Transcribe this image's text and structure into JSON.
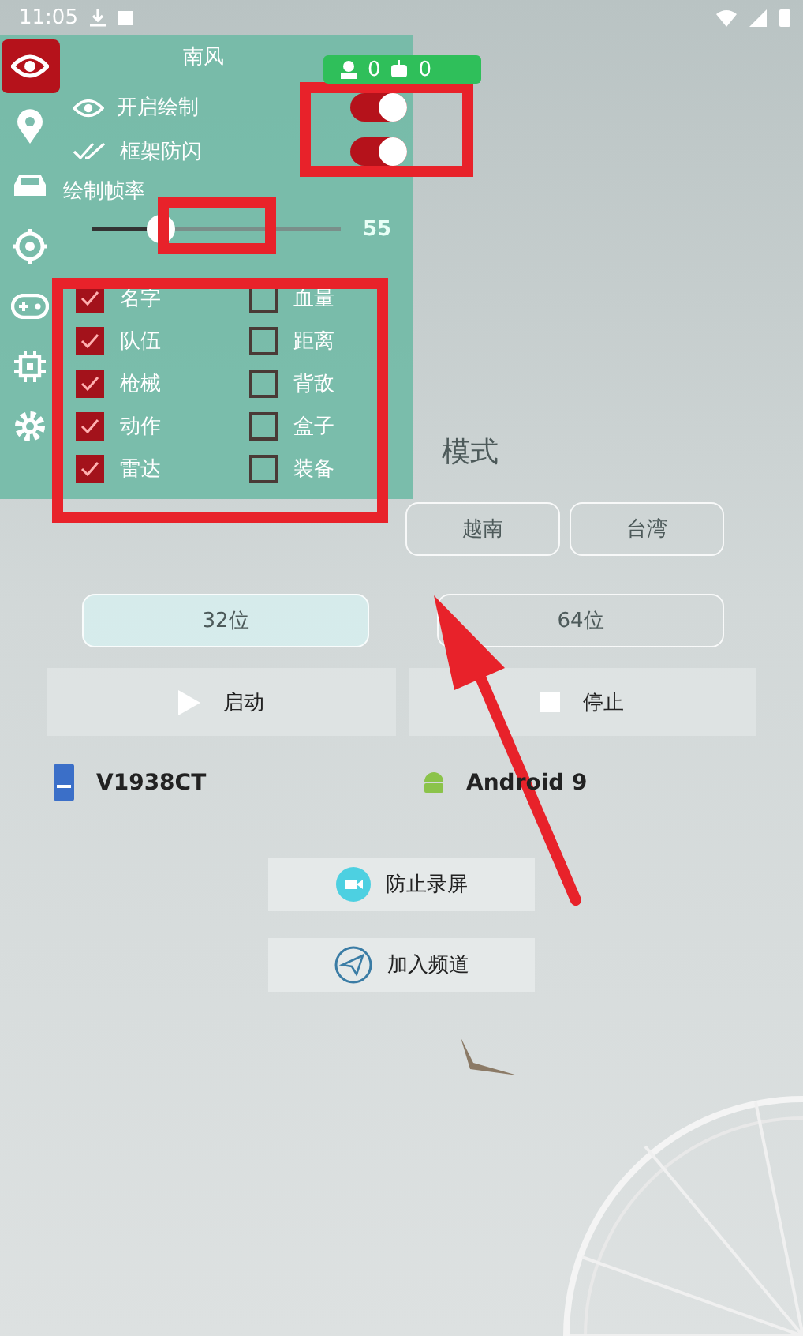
{
  "status_bar": {
    "time": "11:05"
  },
  "menu": {
    "title": "南风",
    "tabs": [
      {
        "selected": true
      },
      {
        "selected": false
      },
      {
        "selected": false
      },
      {
        "selected": false
      },
      {
        "selected": false
      },
      {
        "selected": false
      },
      {
        "selected": false
      }
    ],
    "switches": [
      {
        "label": "开启绘制",
        "on": true
      },
      {
        "label": "框架防闪",
        "on": true
      }
    ],
    "slider": {
      "label": "绘制帧率",
      "level": 0.28,
      "reading": "55"
    },
    "features": [
      {
        "label": "名字",
        "checked": true
      },
      {
        "label": "血量",
        "checked": false
      },
      {
        "label": "队伍",
        "checked": true
      },
      {
        "label": "距离",
        "checked": false
      },
      {
        "label": "枪械",
        "checked": true
      },
      {
        "label": "背敌",
        "checked": false
      },
      {
        "label": "动作",
        "checked": true
      },
      {
        "label": "盒子",
        "checked": false
      },
      {
        "label": "雷达",
        "checked": true
      },
      {
        "label": "装备",
        "checked": false
      }
    ]
  },
  "counter_badge": {
    "values": [
      "0",
      "0"
    ]
  },
  "mode_title": "模式",
  "regions": [
    {
      "label": "越南",
      "selected": false
    },
    {
      "label": "台湾",
      "selected": false
    }
  ],
  "arch": [
    {
      "label": "32位",
      "selected": true
    },
    {
      "label": "64位",
      "selected": false
    }
  ],
  "actions": [
    {
      "label": "启动",
      "kind": "play"
    },
    {
      "label": "停止",
      "kind": "stop"
    }
  ],
  "device": {
    "model": "V1938CT",
    "os": "Android 9"
  },
  "extra_buttons": [
    {
      "label": "防止录屏",
      "kind": "record"
    },
    {
      "label": "加入频道",
      "kind": "send"
    }
  ]
}
